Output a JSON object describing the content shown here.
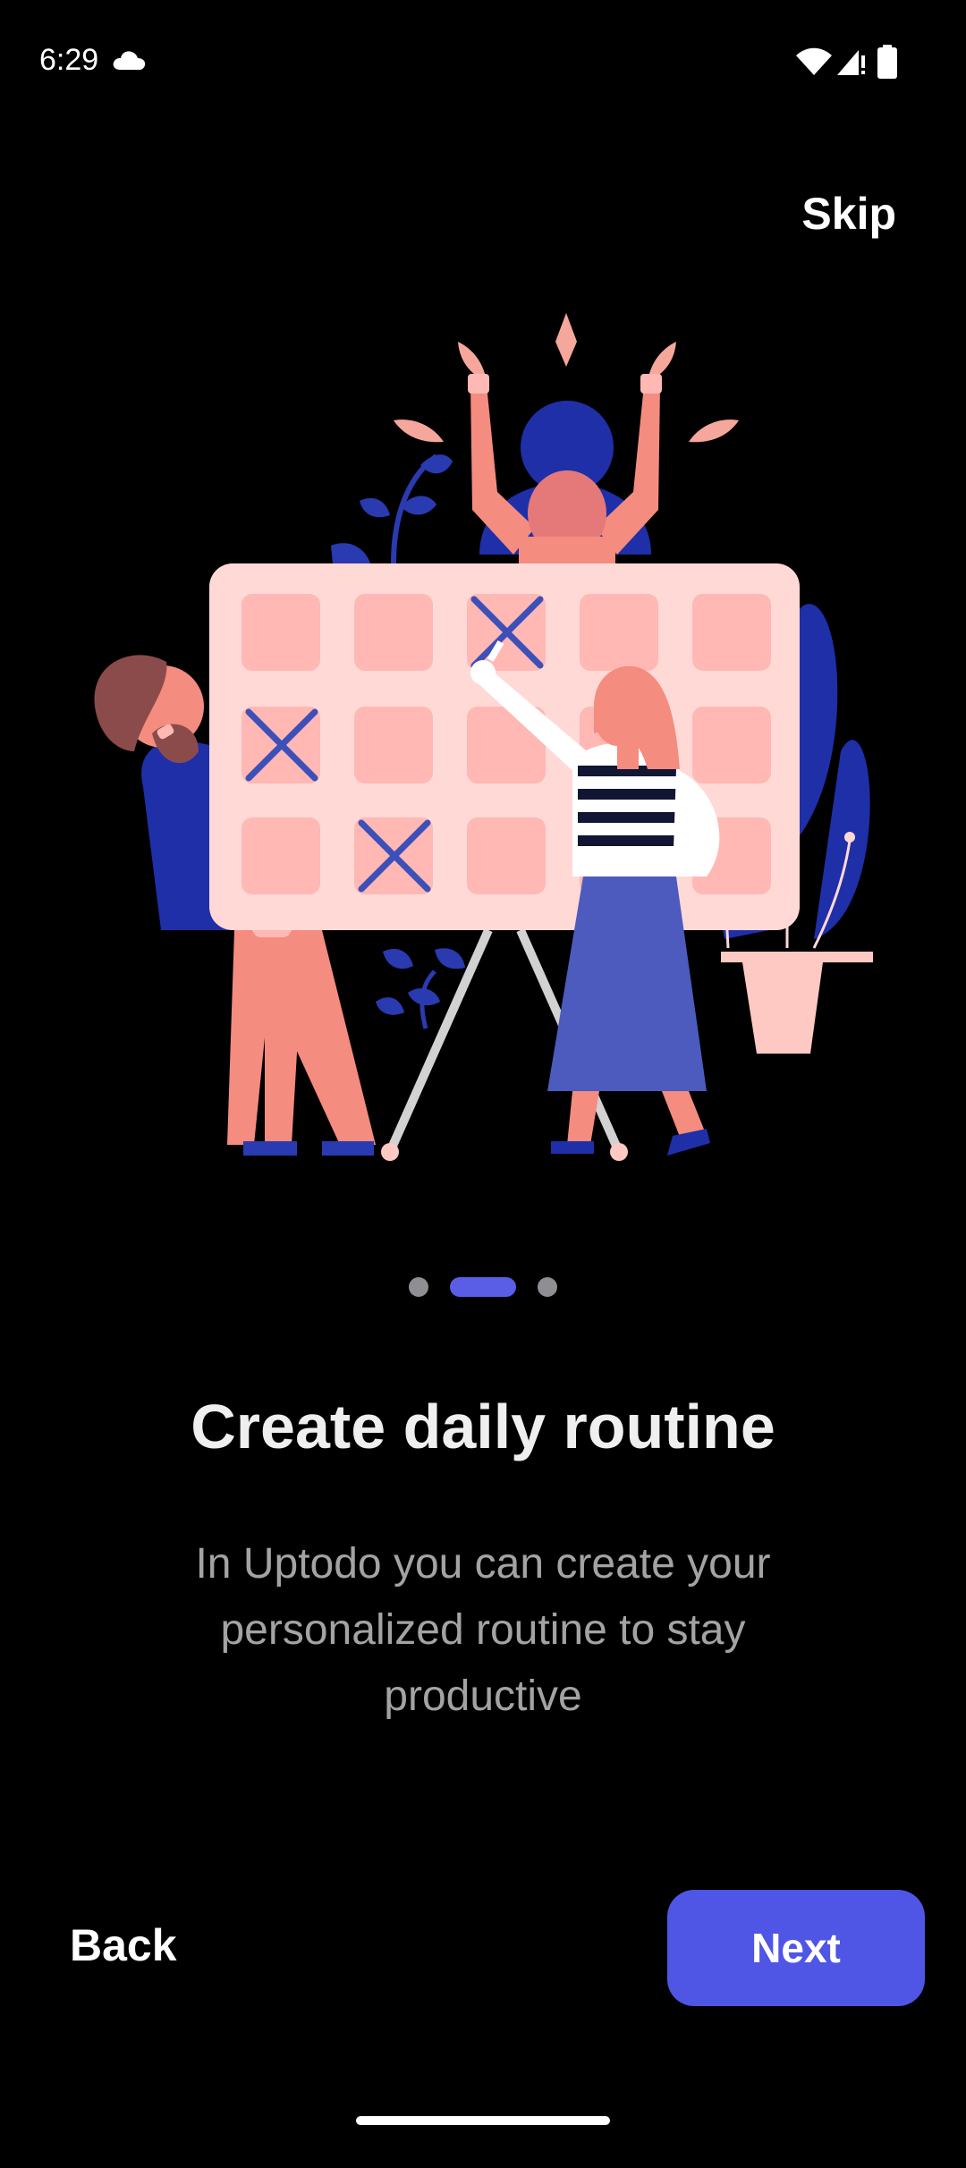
{
  "status_bar": {
    "time": "6:29",
    "icons": [
      "cloud-icon",
      "wifi-icon",
      "signal-icon",
      "battery-icon"
    ]
  },
  "header": {
    "skip_label": "Skip"
  },
  "illustration": {
    "description_icon": "calendar-routine-illustration",
    "colors": {
      "board": "#ffd9d6",
      "cell": "#ffb8b3",
      "mark": "#3d4fb8",
      "skin": "#f48c7f",
      "blue": "#1f2fa8",
      "leaf": "#f5a79c"
    }
  },
  "pager": {
    "total": 3,
    "active_index": 1
  },
  "content": {
    "title": "Create daily routine",
    "description": "In Uptodo  you can create your personalized routine to stay productive"
  },
  "footer": {
    "back_label": "Back",
    "next_label": "Next"
  },
  "colors": {
    "accent": "#4f55e5",
    "background": "#000000",
    "inactive_dot": "#8e8e93",
    "description_text": "#a3a3a3"
  }
}
